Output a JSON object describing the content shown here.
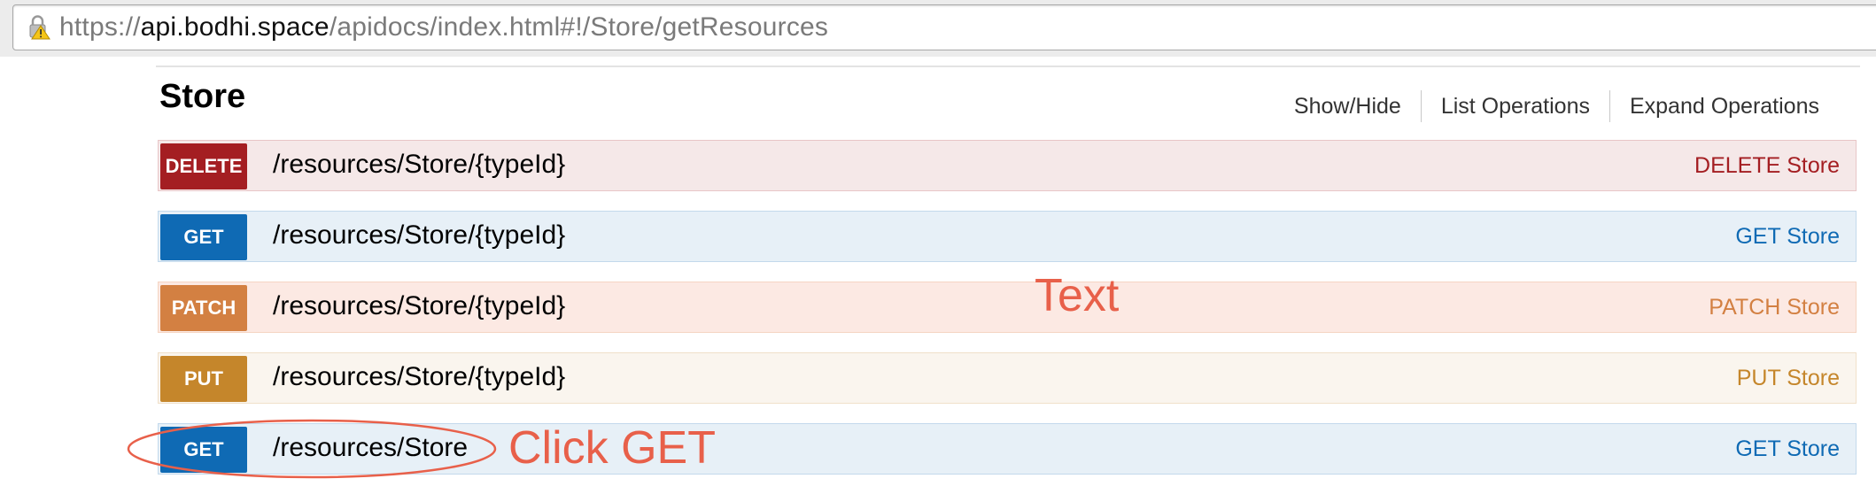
{
  "browser": {
    "url_scheme": "https://",
    "url_host": "api.bodhi.space",
    "url_path": "/apidocs/index.html#!/Store/getResources"
  },
  "section": {
    "title": "Store",
    "links": [
      "Show/Hide",
      "List Operations",
      "Expand Operations"
    ]
  },
  "operations": [
    {
      "method": "DELETE",
      "path": "/resources/Store/{typeId}",
      "summary": "DELETE Store",
      "color": "#a41e22",
      "bg": "#f5e8e8",
      "border": "#e8c6c7",
      "summary_color": "#a41e22"
    },
    {
      "method": "GET",
      "path": "/resources/Store/{typeId}",
      "summary": "GET Store",
      "color": "#0f6ab4",
      "bg": "#e7f0f7",
      "border": "#c3d9ec",
      "summary_color": "#0f6ab4"
    },
    {
      "method": "PATCH",
      "path": "/resources/Store/{typeId}",
      "summary": "PATCH Store",
      "color": "#d38042",
      "bg": "#fce9e3",
      "border": "#f5d5c3",
      "summary_color": "#d38042"
    },
    {
      "method": "PUT",
      "path": "/resources/Store/{typeId}",
      "summary": "PUT Store",
      "color": "#c5862b",
      "bg": "#faf5ee",
      "border": "#f0e0ca",
      "summary_color": "#c5862b"
    },
    {
      "method": "GET",
      "path": "/resources/Store",
      "summary": "GET Store",
      "color": "#0f6ab4",
      "bg": "#e7f0f7",
      "border": "#c3d9ec",
      "summary_color": "#0f6ab4"
    }
  ],
  "annotations": {
    "text_label": "Text",
    "click_label": "Click GET",
    "color": "#e8604a"
  }
}
